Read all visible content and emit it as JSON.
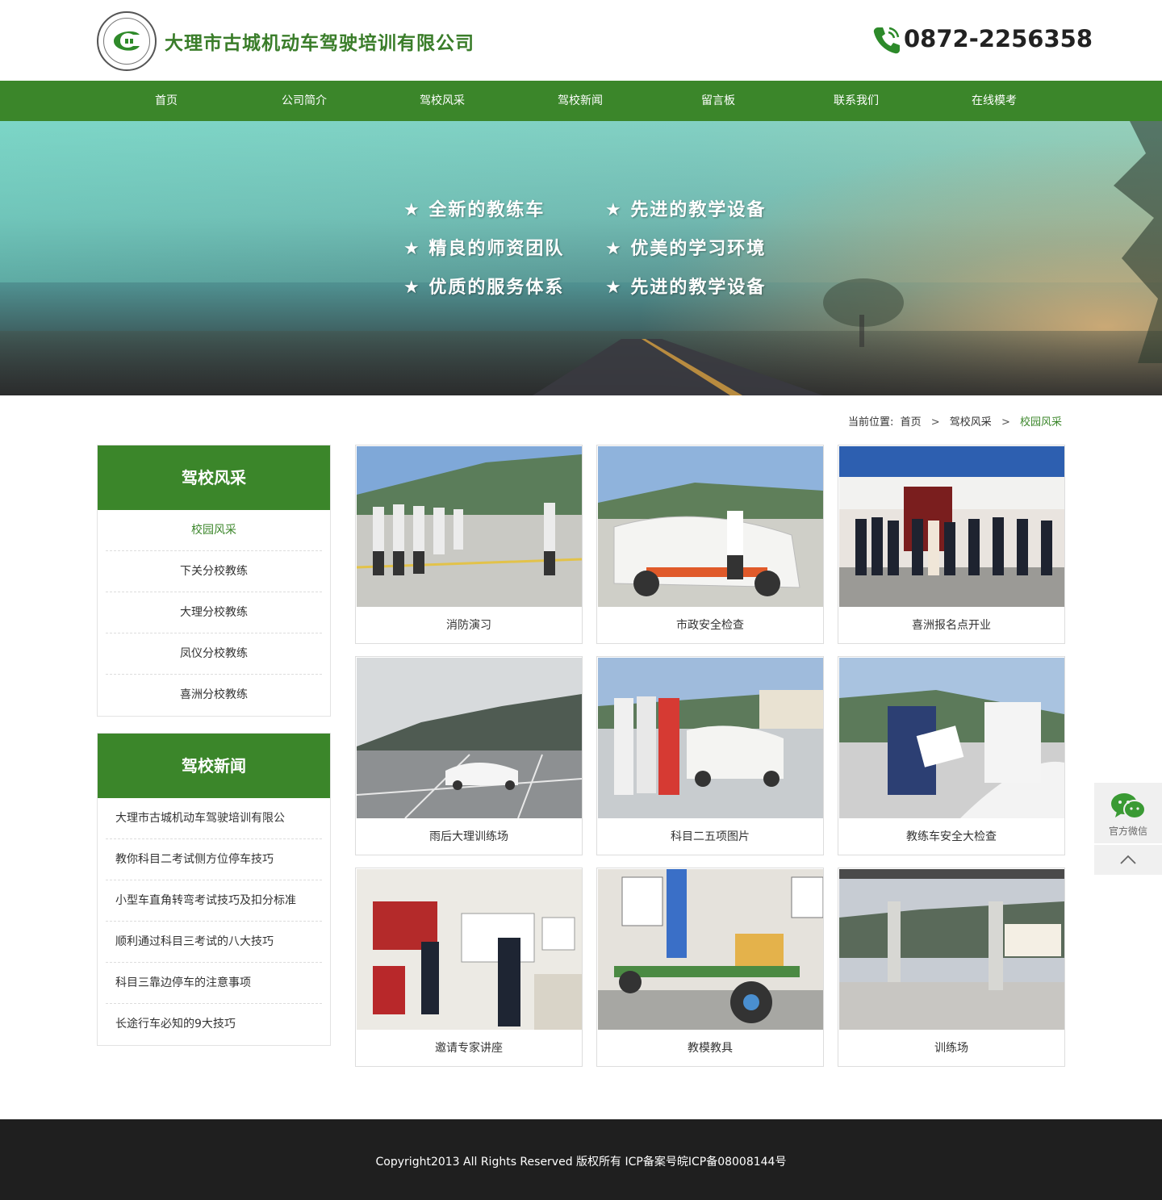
{
  "header": {
    "company_name": "大理市古城机动车驾驶培训有限公司",
    "phone": "0872-2256358"
  },
  "nav": {
    "items": [
      "首页",
      "公司简介",
      "驾校风采",
      "驾校新闻",
      "留言板",
      "联系我们",
      "在线模考"
    ]
  },
  "banner": {
    "slogans": [
      "★ 全新的教练车",
      "★ 先进的教学设备",
      "★ 精良的师资团队",
      "★ 优美的学习环境",
      "★ 优质的服务体系",
      "★ 先进的教学设备"
    ]
  },
  "breadcrumb": {
    "prefix": "当前位置:",
    "home": "首页",
    "section": "驾校风采",
    "current": "校园风采"
  },
  "sidebar": {
    "category_title": "驾校风采",
    "categories": [
      "校园风采",
      "下关分校教练",
      "大理分校教练",
      "凤仪分校教练",
      "喜洲分校教练"
    ],
    "news_title": "驾校新闻",
    "news": [
      "大理市古城机动车驾驶培训有限公",
      "教你科目二考试侧方位停车技巧",
      "小型车直角转弯考试技巧及扣分标准",
      "顺利通过科目三考试的八大技巧",
      "科目三靠边停车的注意事项",
      "长途行车必知的9大技巧"
    ]
  },
  "gallery": {
    "items": [
      "消防演习",
      "市政安全检查",
      "喜洲报名点开业",
      "雨后大理训练场",
      "科目二五项图片",
      "教练车安全大检查",
      "邀请专家讲座",
      "教模教具",
      "训练场"
    ]
  },
  "floating": {
    "wechat_label": "官方微信"
  },
  "footer": {
    "copyright": "Copyright2013 All Rights Reserved 版权所有 ICP备案号皖ICP备08008144号"
  },
  "colors": {
    "brand_green": "#3b862a",
    "footer_bg": "#1f1f1f"
  }
}
